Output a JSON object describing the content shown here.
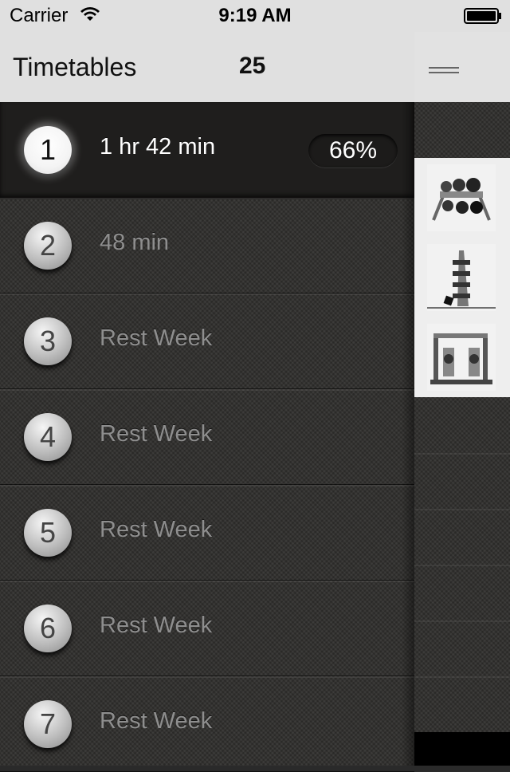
{
  "status_bar": {
    "carrier": "Carrier",
    "time": "9:19 AM"
  },
  "nav": {
    "title": "Timetables",
    "count": "25"
  },
  "rows": [
    {
      "number": "1",
      "label": "1 hr 42 min",
      "percent": "66%",
      "active": true
    },
    {
      "number": "2",
      "label": "48 min"
    },
    {
      "number": "3",
      "label": "Rest Week"
    },
    {
      "number": "4",
      "label": "Rest Week"
    },
    {
      "number": "5",
      "label": "Rest Week"
    },
    {
      "number": "6",
      "label": "Rest Week"
    },
    {
      "number": "7",
      "label": "Rest Week"
    }
  ],
  "side": {
    "thumbnails": [
      "kettlebell-rack-image",
      "dumbbell-tree-image",
      "power-rack-image"
    ]
  }
}
